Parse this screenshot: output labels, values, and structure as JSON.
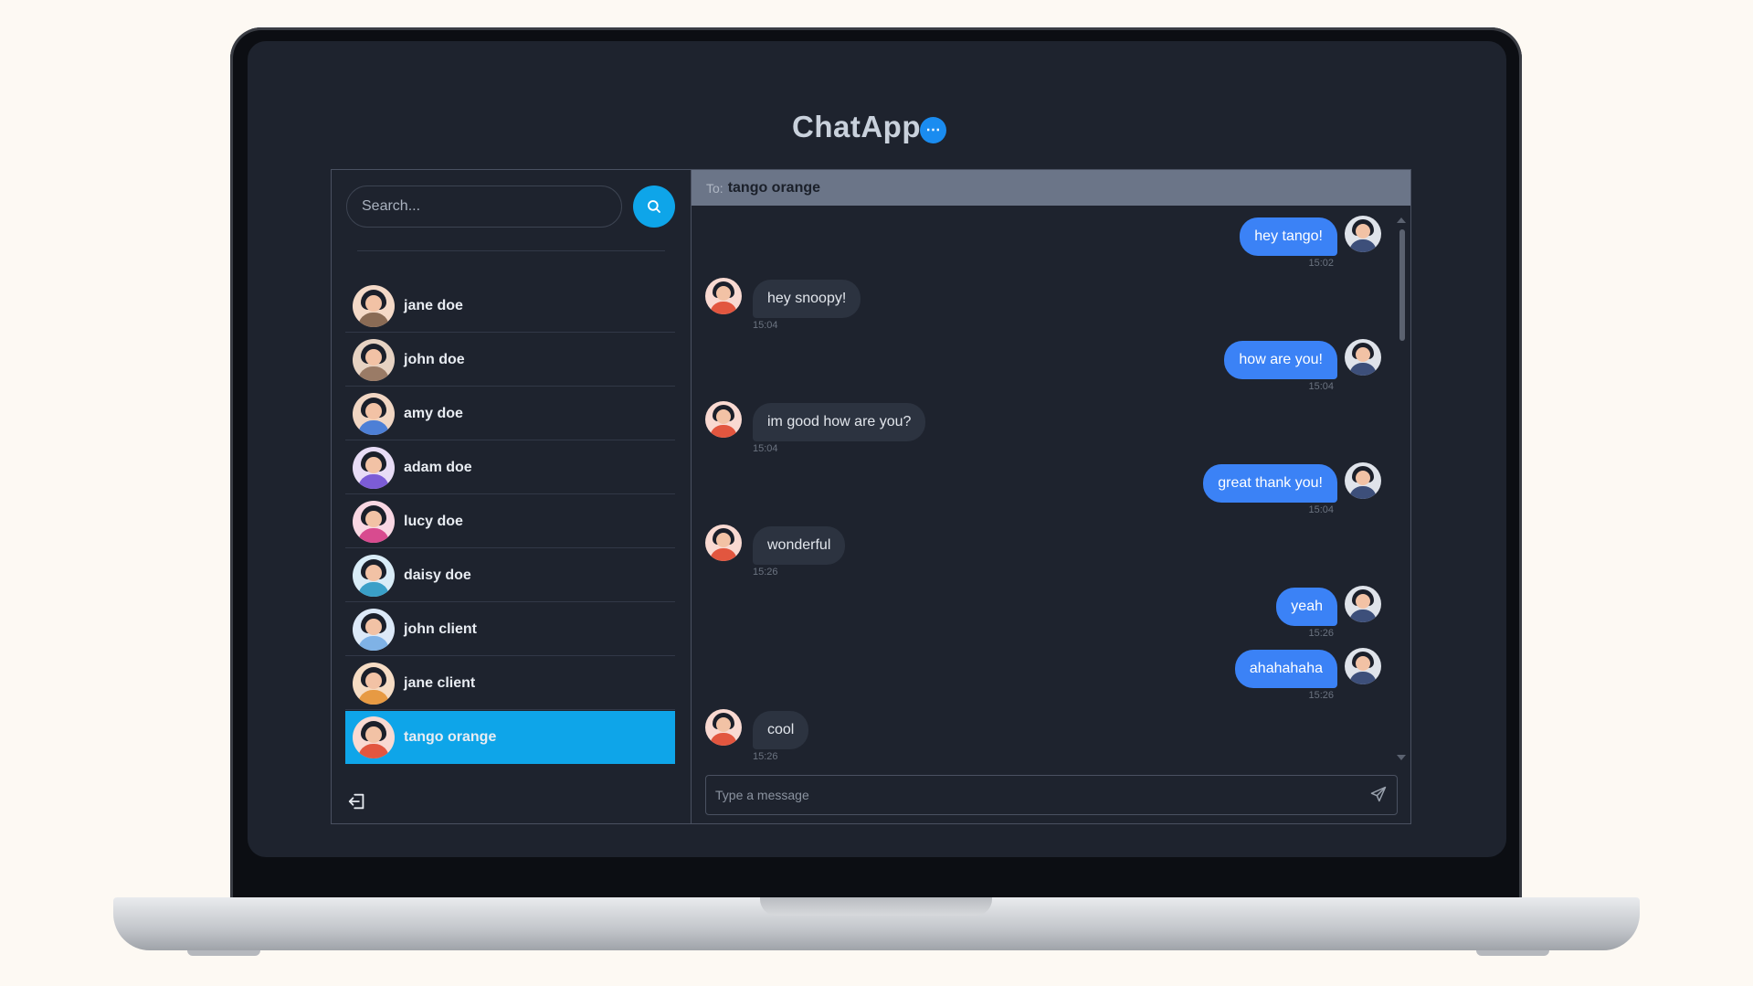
{
  "app": {
    "title": "ChatApp",
    "title_icon": "chat-bubble-icon",
    "accent_color": "#0ea5e9"
  },
  "sidebar": {
    "search_placeholder": "Search...",
    "search_icon": "search-icon",
    "contacts": [
      {
        "name": "jane doe",
        "avatar_bg": "#f4d9c7",
        "shirt": "#8a6b55"
      },
      {
        "name": "john doe",
        "avatar_bg": "#e6d2c2",
        "shirt": "#9a7b66"
      },
      {
        "name": "amy doe",
        "avatar_bg": "#f1d6c3",
        "shirt": "#4d7fd6"
      },
      {
        "name": "adam doe",
        "avatar_bg": "#e8dcf6",
        "shirt": "#7c5cd6"
      },
      {
        "name": "lucy doe",
        "avatar_bg": "#f9d7e3",
        "shirt": "#d84b8f"
      },
      {
        "name": "daisy doe",
        "avatar_bg": "#d9ecf7",
        "shirt": "#3aa0c8"
      },
      {
        "name": "john client",
        "avatar_bg": "#dce9f8",
        "shirt": "#7fb2e6"
      },
      {
        "name": "jane client",
        "avatar_bg": "#f6dcc4",
        "shirt": "#e79a43"
      },
      {
        "name": "tango orange",
        "avatar_bg": "#f9d9d1",
        "shirt": "#e2563f"
      }
    ],
    "active_contact": "tango orange",
    "logout_icon": "logout-icon"
  },
  "chat": {
    "to_label": "To:",
    "recipient": "tango orange",
    "messages": [
      {
        "text": "hey tango!",
        "time": "15:02",
        "direction": "out"
      },
      {
        "text": "hey snoopy!",
        "time": "15:04",
        "direction": "in"
      },
      {
        "text": "how are you!",
        "time": "15:04",
        "direction": "out"
      },
      {
        "text": "im good how are you?",
        "time": "15:04",
        "direction": "in"
      },
      {
        "text": "great thank you!",
        "time": "15:04",
        "direction": "out"
      },
      {
        "text": "wonderful",
        "time": "15:26",
        "direction": "in"
      },
      {
        "text": "yeah",
        "time": "15:26",
        "direction": "out"
      },
      {
        "text": "ahahahaha",
        "time": "15:26",
        "direction": "out"
      },
      {
        "text": "cool",
        "time": "15:26",
        "direction": "in"
      }
    ],
    "input_placeholder": "Type a message",
    "send_icon": "send-icon",
    "colors": {
      "outgoing": "#3b82f6",
      "incoming": "#2c3340"
    }
  }
}
